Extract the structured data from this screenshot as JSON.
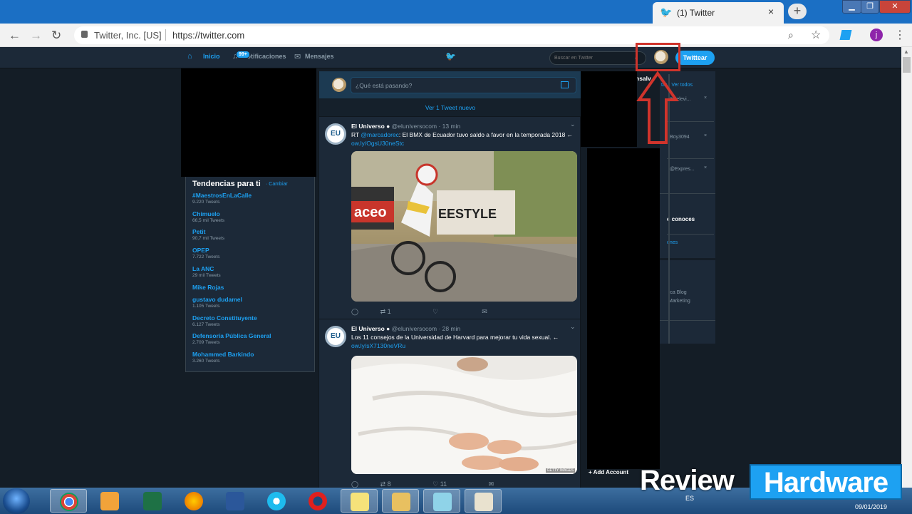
{
  "browser": {
    "tab_title": "(1) Twitter",
    "close_label": "×",
    "new_tab_label": "+",
    "site_identity": "Twitter, Inc. [US]",
    "url": "https://twitter.com",
    "profile_initial": "j"
  },
  "twitter_nav": {
    "home": "Inicio",
    "notifications": "Notificaciones",
    "notifications_badge": "99+",
    "messages": "Mensajes",
    "search_placeholder": "Buscar en Twitter",
    "tweet_button": "Twittear"
  },
  "trends": {
    "title": "Tendencias para ti",
    "change": "· Cambiar",
    "items": [
      {
        "name": "#MaestrosEnLaCalle",
        "count": "9.220 Tweets"
      },
      {
        "name": "Chimuelo",
        "count": "66,5 mil Tweets"
      },
      {
        "name": "Petit",
        "count": "90,7 mil Tweets"
      },
      {
        "name": "OPEP",
        "count": "7.722 Tweets"
      },
      {
        "name": "La ANC",
        "count": "29 mil Tweets"
      },
      {
        "name": "Mike Rojas",
        "count": ""
      },
      {
        "name": "gustavo dudamel",
        "count": "1.105 Tweets"
      },
      {
        "name": "Decreto Constituyente",
        "count": "6.127 Tweets"
      },
      {
        "name": "Defensoría Pública General",
        "count": "2.709 Tweets"
      },
      {
        "name": "Mohammed Barkindo",
        "count": "3.260 Tweets"
      }
    ]
  },
  "compose": {
    "placeholder": "¿Qué está pasando?"
  },
  "new_tweets_bar": "Ver 1 Tweet nuevo",
  "tweets": [
    {
      "logo": "EU",
      "author": "El Universo",
      "handle": "@eluniversocom · 13 min",
      "text_prefix": "RT ",
      "mention": "@marcadorec",
      "text_rest": ":  El BMX de Ecuador tuvo saldo a favor en la temporada 2018 ←",
      "link": "ow.ly/OgsU30neStc",
      "retweets": "1",
      "likes": ""
    },
    {
      "logo": "EU",
      "author": "El Universo",
      "handle": "@eluniversocom · 28 min",
      "text_prefix": "",
      "mention": "",
      "text_rest": "Los 11 consejos de la Universidad de Harvard para mejorar tu vida sexual. ←",
      "link": "ow.ly/sX7130neVRu",
      "retweets": "8",
      "likes": "11",
      "media_credit": "GETTY IMAGES"
    }
  ],
  "right_sidebar": {
    "heading_fragment": "nsalv",
    "links_fragment": "tar · Ver todos",
    "handle1": "Itctelevi...",
    "handle2": "Boy3094",
    "handle3": "@Expres...",
    "know_fragment": "e conoces",
    "more_fragment": "ones",
    "footer1": "rca  Blog",
    "footer2": "Marketing",
    "add_account": "+  Add Account"
  },
  "watermark": {
    "word1": "Review",
    "word2": "Hardware"
  },
  "taskbar": {
    "language": "ES",
    "date": "09/01/2019"
  }
}
